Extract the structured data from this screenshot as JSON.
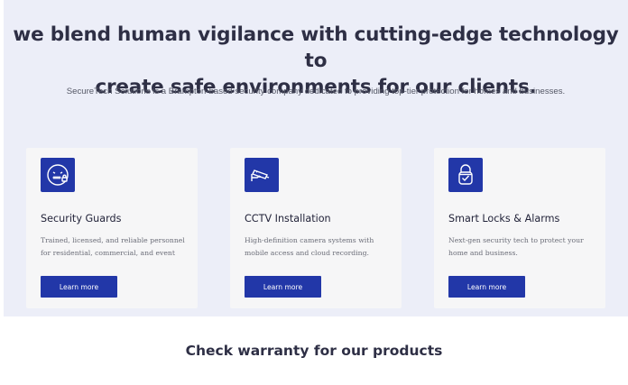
{
  "hero": {
    "headline_line1": "we blend human vigilance with cutting-edge technology to",
    "headline_line2": "create safe environments for our clients.",
    "subtitle": "SecureTech Solutions is a Brampton-based security company dedicated to providing top-tier protection for homes and businesses."
  },
  "services": [
    {
      "icon": "security-guard-face-icon",
      "title": "Security Guards",
      "desc_line1": "Trained, licensed, and reliable personnel",
      "desc_line2": "for residential, commercial, and event",
      "button": "Learn more"
    },
    {
      "icon": "cctv-camera-icon",
      "title": "CCTV Installation",
      "desc_line1": "High-definition camera systems with",
      "desc_line2": "mobile access and cloud recording.",
      "button": "Learn more"
    },
    {
      "icon": "smart-lock-icon",
      "title": "Smart Locks & Alarms",
      "desc_line1": "Next-gen security tech to protect your",
      "desc_line2": "home and business.",
      "button": "Learn more"
    }
  ],
  "warranty": {
    "heading": "Check warranty for our products"
  },
  "colors": {
    "accent": "#2237a8",
    "hero_background": "#eceef8",
    "card_background": "#f6f6f7"
  }
}
